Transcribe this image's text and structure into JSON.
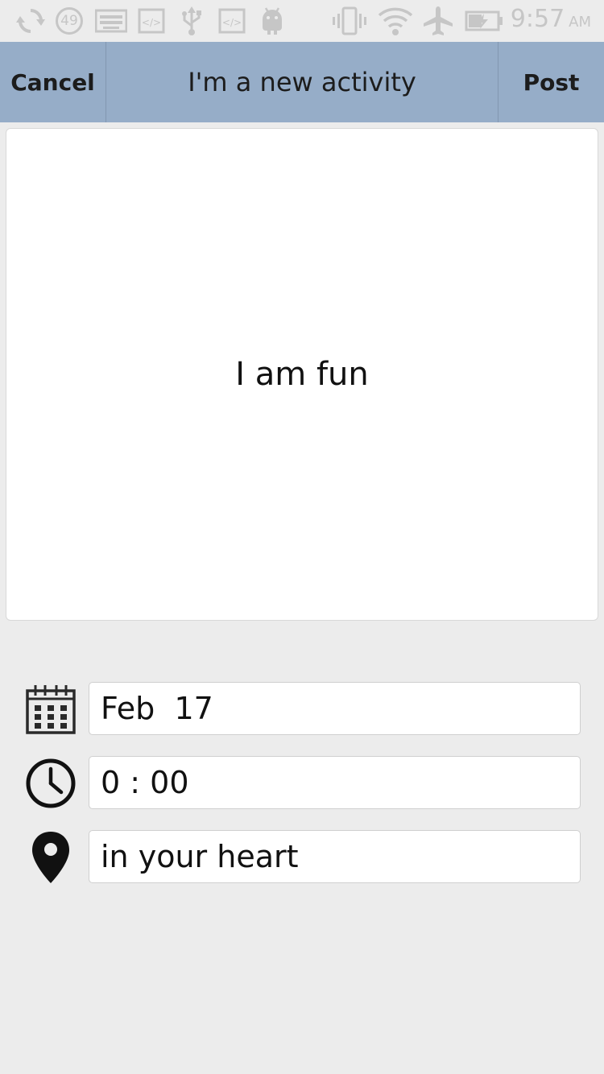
{
  "status_bar": {
    "notification_count": "49",
    "time": "9:57",
    "ampm": "AM"
  },
  "header": {
    "cancel_label": "Cancel",
    "title": "I'm a new activity",
    "post_label": "Post",
    "background_color": "#96adc8"
  },
  "card": {
    "text": "I am fun"
  },
  "form": {
    "date_value": "Feb  17",
    "time_value": "0 : 00",
    "location_value": "in your heart"
  },
  "icons": {
    "date": "calendar-icon",
    "time": "clock-icon",
    "location": "location-pin-icon"
  }
}
